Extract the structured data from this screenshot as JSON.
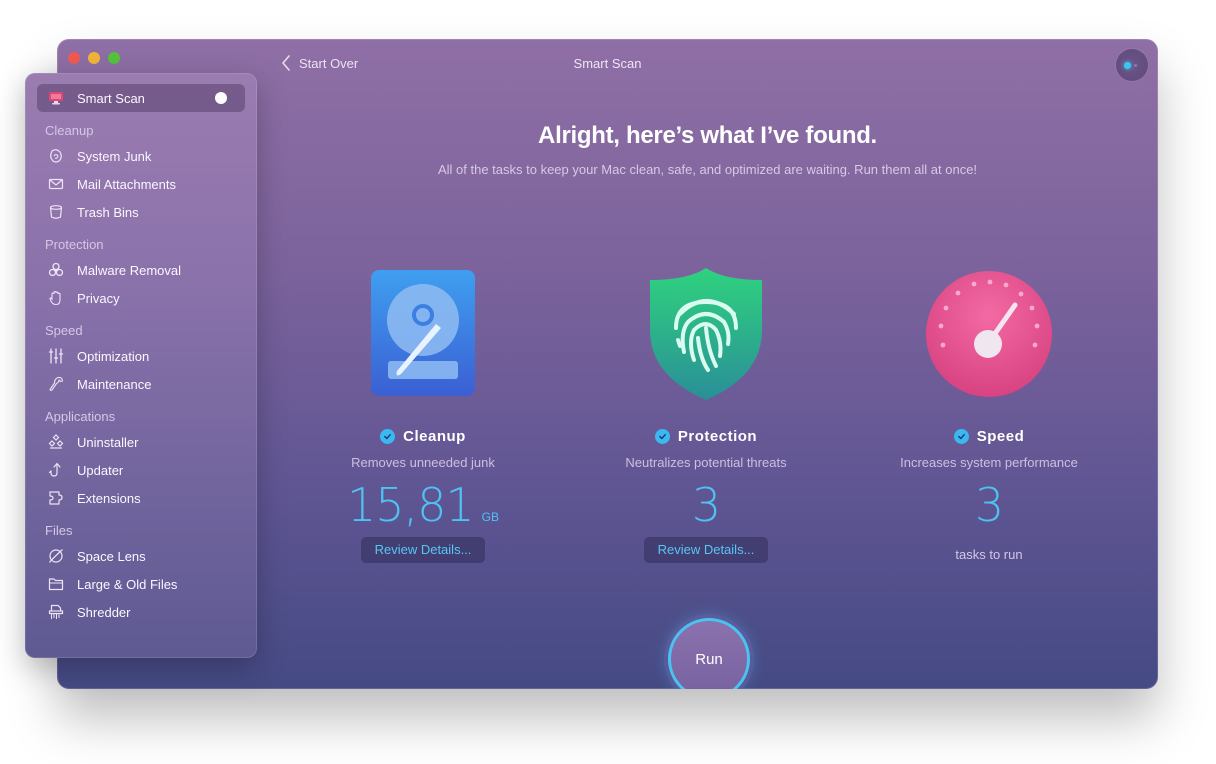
{
  "window": {
    "title": "Smart Scan",
    "back_label": "Start Over",
    "traffic_lights": {
      "close": "#ee5a53",
      "minimize": "#f0b43a",
      "zoom": "#55c23c"
    }
  },
  "header": {
    "headline": "Alright, here’s what I’ve found.",
    "subline": "All of the tasks to keep your Mac clean, safe, and optimized are waiting. Run them all at once!"
  },
  "sidebar": {
    "active_item": {
      "label": "Smart Scan",
      "icon": "monitor-icon"
    },
    "sections": [
      {
        "label": "Cleanup",
        "items": [
          {
            "label": "System Junk",
            "icon": "system-junk-icon"
          },
          {
            "label": "Mail Attachments",
            "icon": "envelope-icon"
          },
          {
            "label": "Trash Bins",
            "icon": "trash-bin-icon"
          }
        ]
      },
      {
        "label": "Protection",
        "items": [
          {
            "label": "Malware Removal",
            "icon": "biohazard-icon"
          },
          {
            "label": "Privacy",
            "icon": "hand-icon"
          }
        ]
      },
      {
        "label": "Speed",
        "items": [
          {
            "label": "Optimization",
            "icon": "sliders-icon"
          },
          {
            "label": "Maintenance",
            "icon": "wrench-icon"
          }
        ]
      },
      {
        "label": "Applications",
        "items": [
          {
            "label": "Uninstaller",
            "icon": "uninstaller-icon"
          },
          {
            "label": "Updater",
            "icon": "updater-icon"
          },
          {
            "label": "Extensions",
            "icon": "puzzle-icon"
          }
        ]
      },
      {
        "label": "Files",
        "items": [
          {
            "label": "Space Lens",
            "icon": "planet-icon"
          },
          {
            "label": "Large & Old Files",
            "icon": "folder-icon"
          },
          {
            "label": "Shredder",
            "icon": "shredder-icon"
          }
        ]
      }
    ]
  },
  "cards": [
    {
      "title": "Cleanup",
      "description": "Removes unneeded junk",
      "value": "15,81",
      "unit": "GB",
      "button": "Review Details...",
      "icon": "hard-drive-icon"
    },
    {
      "title": "Protection",
      "description": "Neutralizes potential threats",
      "value": "3",
      "button": "Review Details...",
      "icon": "fingerprint-shield-icon"
    },
    {
      "title": "Speed",
      "description": "Increases system performance",
      "value": "3",
      "footer": "tasks to run",
      "icon": "speedometer-icon"
    }
  ],
  "run_button": {
    "label": "Run"
  },
  "colors": {
    "accent": "#4fc2f2",
    "check": "#3ab8ef",
    "run_ring": "#49c4f2"
  }
}
